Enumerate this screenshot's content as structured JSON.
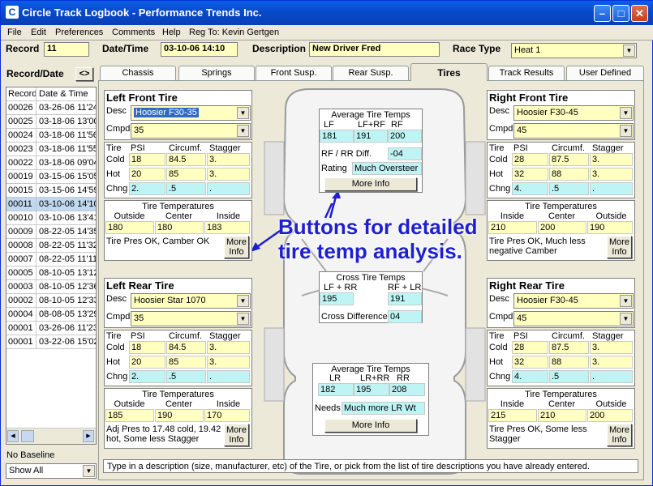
{
  "window": {
    "title": "Circle Track Logbook - Performance Trends Inc.",
    "app_icon": "track-icon",
    "min_icon": "minimize-icon",
    "max_icon": "maximize-icon",
    "close_icon": "close-icon"
  },
  "menu": [
    "File",
    "Edit",
    "Preferences",
    "Comments",
    "Help",
    "Reg To: Kevin Gertgen"
  ],
  "header": {
    "record_label": "Record",
    "record_value": "11",
    "date_label": "Date/Time",
    "date_value": "03-10-06 14:10",
    "desc_label": "Description",
    "desc_value": "New Driver Fred",
    "race_label": "Race Type",
    "race_value": "Heat 1"
  },
  "left": {
    "title": "Record/Date",
    "toggle": "<>",
    "col1": "Record",
    "col2": "Date & Time",
    "rows": [
      {
        "rec": "00026",
        "date": "03-26-06 11'24"
      },
      {
        "rec": "00025",
        "date": "03-18-06 13'00"
      },
      {
        "rec": "00024",
        "date": "03-18-06 11'56"
      },
      {
        "rec": "00023",
        "date": "03-18-06 11'55"
      },
      {
        "rec": "00022",
        "date": "03-18-06 09'04"
      },
      {
        "rec": "00019",
        "date": "03-15-06 15'05"
      },
      {
        "rec": "00015",
        "date": "03-15-06 14'59"
      },
      {
        "rec": "00011",
        "date": "03-10-06 14'10"
      },
      {
        "rec": "00010",
        "date": "03-10-06 13'41"
      },
      {
        "rec": "00009",
        "date": "08-22-05 14'35"
      },
      {
        "rec": "00008",
        "date": "08-22-05 11'32"
      },
      {
        "rec": "00007",
        "date": "08-22-05 11'11"
      },
      {
        "rec": "00005",
        "date": "08-10-05 13'12"
      },
      {
        "rec": "00003",
        "date": "08-10-05 12'36"
      },
      {
        "rec": "00002",
        "date": "08-10-05 12'33"
      },
      {
        "rec": "00004",
        "date": "08-08-05 13'29"
      },
      {
        "rec": "00001",
        "date": "03-26-06 11'23"
      },
      {
        "rec": "00001",
        "date": "03-22-06 15'02"
      }
    ],
    "baseline_label": "No Baseline",
    "baseline_value": "Show All"
  },
  "tabs": [
    "Chassis",
    "Springs",
    "Front Susp.",
    "Rear Susp.",
    "Tires",
    "Track Results",
    "User Defined"
  ],
  "tire_labels": {
    "desc": "Desc",
    "cmpd": "Cmpd",
    "tire": "Tire",
    "psi": "PSI",
    "circumf": "Circumf.",
    "stagger": "Stagger",
    "cold": "Cold",
    "hot": "Hot",
    "chng": "Chng",
    "temps_title": "Tire Temperatures",
    "outside": "Outside",
    "center": "Center",
    "inside": "Inside",
    "more": "More",
    "info": "Info"
  },
  "lf": {
    "title": "Left Front Tire",
    "desc": "Hoosier F30-35",
    "cmpd": "35",
    "cold": [
      "18",
      "84.5",
      "3."
    ],
    "hot": [
      "20",
      "85",
      "3."
    ],
    "chng": [
      "2.",
      ".5",
      "."
    ],
    "temps": [
      "180",
      "180",
      "183"
    ],
    "note": "Tire Pres OK, Camber OK"
  },
  "rf": {
    "title": "Right Front Tire",
    "desc": "Hoosier F30-45",
    "cmpd": "45",
    "cold": [
      "28",
      "87.5",
      "3."
    ],
    "hot": [
      "32",
      "88",
      "3."
    ],
    "chng": [
      "4.",
      ".5",
      "."
    ],
    "temps": [
      "210",
      "200",
      "190"
    ],
    "note": "Tire Pres OK, Much less negative Camber"
  },
  "lr": {
    "title": "Left Rear Tire",
    "desc": "Hoosier Star 1070",
    "cmpd": "35",
    "cold": [
      "18",
      "84.5",
      "3."
    ],
    "hot": [
      "20",
      "85",
      "3."
    ],
    "chng": [
      "2.",
      ".5",
      "."
    ],
    "temps": [
      "185",
      "190",
      "170"
    ],
    "note": "Adj Pres to 17.48 cold, 19.42 hot, Some less  Stagger"
  },
  "rr": {
    "title": "Right Rear Tire",
    "desc": "Hoosier F30-45",
    "cmpd": "45",
    "cold": [
      "28",
      "87.5",
      "3."
    ],
    "hot": [
      "32",
      "88",
      "3."
    ],
    "chng": [
      "4.",
      ".5",
      "."
    ],
    "temps": [
      "215",
      "210",
      "200"
    ],
    "note": "Tire Pres OK, Some less Stagger"
  },
  "front_avg": {
    "title": "Average Tire Temps",
    "h1": "LF",
    "h2": "LF+RF",
    "h3": "RF",
    "v1": "181",
    "v2": "191",
    "v3": "200",
    "diff_label": "RF / RR Diff.",
    "diff_value": "-04",
    "rating_label": "Rating",
    "rating_value": "Much Oversteer",
    "button": "More Info"
  },
  "cross": {
    "title": "Cross Tire Temps",
    "h1": "LF + RR",
    "h2": "RF + LR",
    "v1": "195",
    "v2": "191",
    "diff_label": "Cross Difference",
    "diff_value": "04"
  },
  "rear_avg": {
    "title": "Average Tire Temps",
    "h1": "LR",
    "h2": "LR+RR",
    "h3": "RR",
    "v1": "182",
    "v2": "195",
    "v3": "208",
    "needs_label": "Needs",
    "needs_value": "Much more LR Wt",
    "button": "More Info"
  },
  "annotation": "Buttons for detailed tire temp analysis.",
  "status": "Type in a description (size, manufacturer, etc) of the Tire, or pick from the list of tire descriptions you have already entered."
}
